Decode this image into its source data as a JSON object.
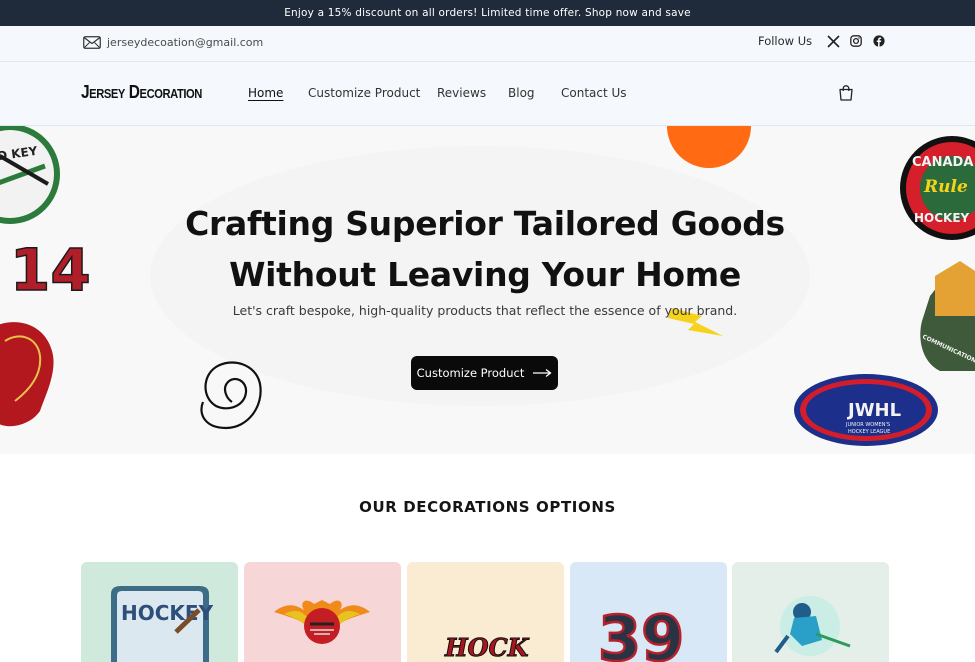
{
  "announcement": "Enjoy a 15% discount on all orders! Limited time offer. Shop now and save",
  "topbar": {
    "email": "jerseydecoation@gmail.com",
    "follow_label": "Follow Us",
    "social_icons": [
      "x-icon",
      "instagram-icon",
      "facebook-icon"
    ]
  },
  "header": {
    "logo": "Jersey Decoration",
    "nav": [
      "Home",
      "Customize Product",
      "Reviews",
      "Blog",
      "Contact Us"
    ],
    "active_nav": "Home",
    "cart_icon": "cart-icon"
  },
  "hero": {
    "title_line1": "Crafting Superior Tailored Goods",
    "title_line2": "Without Leaving Your Home",
    "subtitle": "Let's craft bespoke, high-quality products that reflect the essence of your brand.",
    "cta_label": "Customize Product",
    "patches": {
      "left_top": "ELD KEY",
      "left_number": "14",
      "right_top_line1": "CANADA",
      "right_top_line2": "Rule",
      "right_top_line3": "HOCKEY",
      "right_mid": "COMMUNICATION",
      "right_bottom_line1": "JWHL",
      "right_bottom_line2": "JUNIOR WOMEN'S",
      "right_bottom_line3": "HOCKEY LEAGUE"
    }
  },
  "section": {
    "title": "OUR DECORATIONS OPTIONS"
  },
  "cards": [
    {
      "name": "patch-card",
      "color": "#cfe9dc",
      "label": "HOCKEY"
    },
    {
      "name": "chenille-card",
      "color": "#f7d6d8",
      "label": ""
    },
    {
      "name": "tackle-twill-card",
      "color": "#f9ecd3",
      "label": "HOCK"
    },
    {
      "name": "numbers-card",
      "color": "#d9e8f6",
      "label": "39"
    },
    {
      "name": "sublimation-card",
      "color": "#e4efe9",
      "label": ""
    }
  ],
  "colors": {
    "announcement_bg": "#1f2a3a",
    "topbar_bg": "#f5f8fc",
    "cta_bg": "#0a0a0a"
  }
}
